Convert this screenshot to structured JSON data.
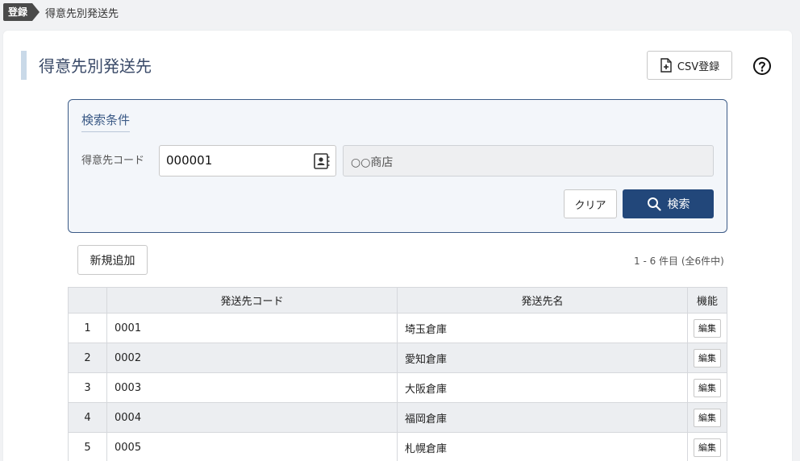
{
  "breadcrumb": {
    "tag": "登録",
    "current": "得意先別発送先"
  },
  "header": {
    "title": "得意先別発送先",
    "csv_button": "CSV登録"
  },
  "search": {
    "title": "検索条件",
    "code_label": "得意先コード",
    "code_value": "000001",
    "name_value": "○○商店",
    "clear_button": "クリア",
    "search_button": "検索"
  },
  "list": {
    "add_button": "新規追加",
    "count_text": "1 - 6 件目 (全6件中)",
    "columns": [
      "",
      "発送先コード",
      "発送先名",
      "機能"
    ],
    "rows": [
      {
        "no": "1",
        "code": "0001",
        "name": "埼玉倉庫",
        "action": "編集"
      },
      {
        "no": "2",
        "code": "0002",
        "name": "愛知倉庫",
        "action": "編集"
      },
      {
        "no": "3",
        "code": "0003",
        "name": "大阪倉庫",
        "action": "編集"
      },
      {
        "no": "4",
        "code": "0004",
        "name": "福岡倉庫",
        "action": "編集"
      },
      {
        "no": "5",
        "code": "0005",
        "name": "札幌倉庫",
        "action": "編集"
      }
    ]
  },
  "icons": [
    "file-plus-icon",
    "help-icon",
    "contact-picker-icon",
    "search-icon"
  ],
  "colors": {
    "accent": "#22477a",
    "panel_border": "#3b5a86",
    "title": "#3a4a68"
  }
}
